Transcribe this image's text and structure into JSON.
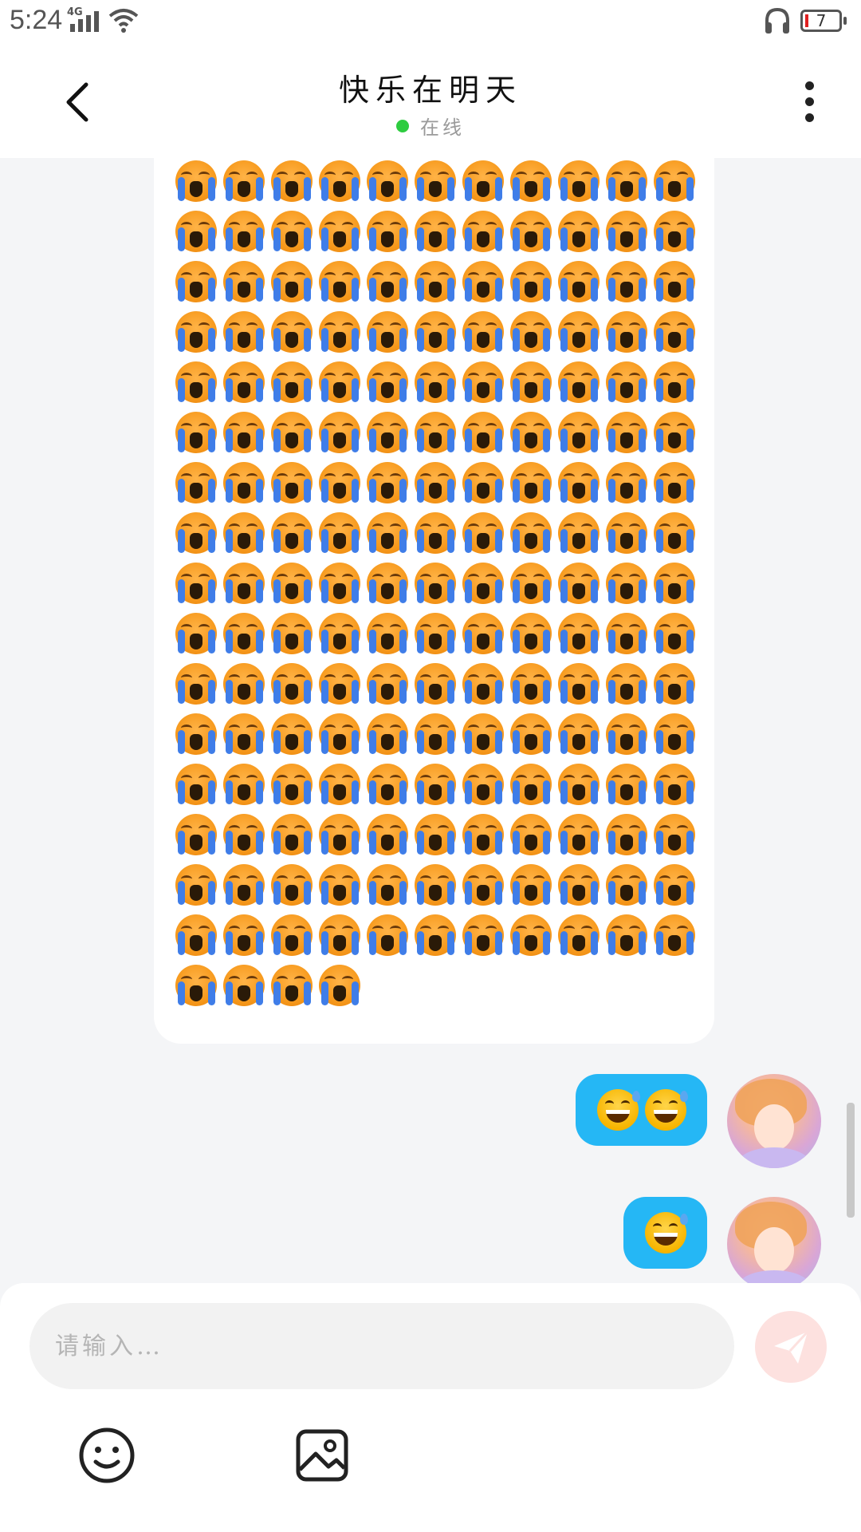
{
  "status_bar": {
    "time": "5:24",
    "network": "4G",
    "battery_level": "7",
    "icons": [
      "signal-icon",
      "wifi-icon",
      "headphone-icon",
      "battery-icon"
    ]
  },
  "header": {
    "title": "快乐在明天",
    "status": "在线",
    "status_color": "#2ecc40",
    "back_icon": "chevron-left-icon",
    "more_icon": "more-vertical-icon"
  },
  "messages": [
    {
      "direction": "incoming",
      "content": "😭",
      "repeat_visible": 180
    },
    {
      "direction": "outgoing",
      "content": "😅😅"
    },
    {
      "direction": "outgoing",
      "content": "😅"
    }
  ],
  "composer": {
    "placeholder": "请输入…",
    "send_icon": "send-icon",
    "emoji_icon": "emoji-icon",
    "image_icon": "image-icon"
  },
  "colors": {
    "outgoing_bubble": "#25b7f5",
    "incoming_bubble": "#ffffff",
    "send_button_disabled": "#fde1df",
    "background": "#f4f5f7"
  }
}
